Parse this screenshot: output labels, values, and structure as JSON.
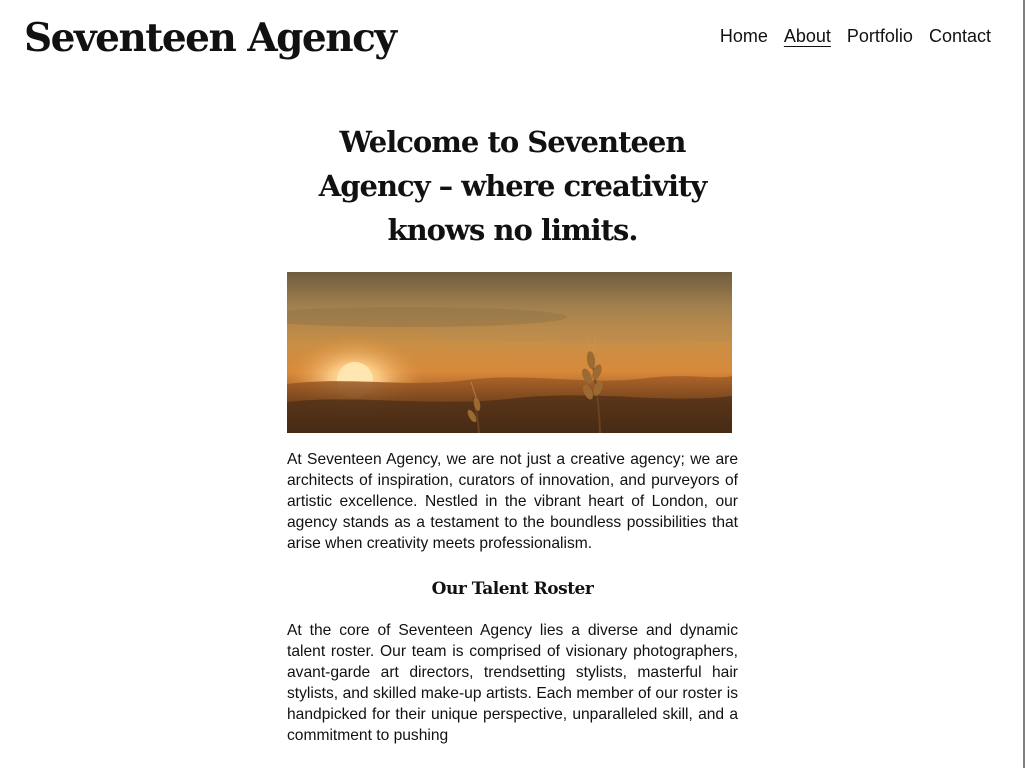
{
  "site": {
    "title": "Seventeen Agency"
  },
  "nav": {
    "items": [
      {
        "label": "Home",
        "active": false
      },
      {
        "label": "About",
        "active": true
      },
      {
        "label": "Portfolio",
        "active": false
      },
      {
        "label": "Contact",
        "active": false
      }
    ]
  },
  "main": {
    "heading": "Welcome to Seventeen Agency – where creativity knows no limits.",
    "hero_image": {
      "description": "sunset over wheat field"
    },
    "intro": "At Seventeen Agency, we are not just a creative agency; we are architects of inspiration, curators of innovation, and purveyors of artistic excellence. Nestled in the vibrant heart of London, our agency stands as a testament to the boundless possibilities that arise when creativity meets professionalism.",
    "roster_heading": "Our Talent Roster",
    "roster_text": "At the core of Seventeen Agency lies a diverse and dynamic talent roster. Our team is comprised of visionary photographers, avant-garde art directors, trendsetting stylists, masterful hair stylists, and skilled make-up artists. Each member of our roster is handpicked for their unique perspective, unparalleled skill, and a commitment to pushing"
  },
  "colors": {
    "text": "#111111",
    "background": "#ffffff",
    "sky_top": "#6e5a3c",
    "sky_glow": "#d89540",
    "sun": "#ffe3a8",
    "field": "#4a2d17"
  }
}
